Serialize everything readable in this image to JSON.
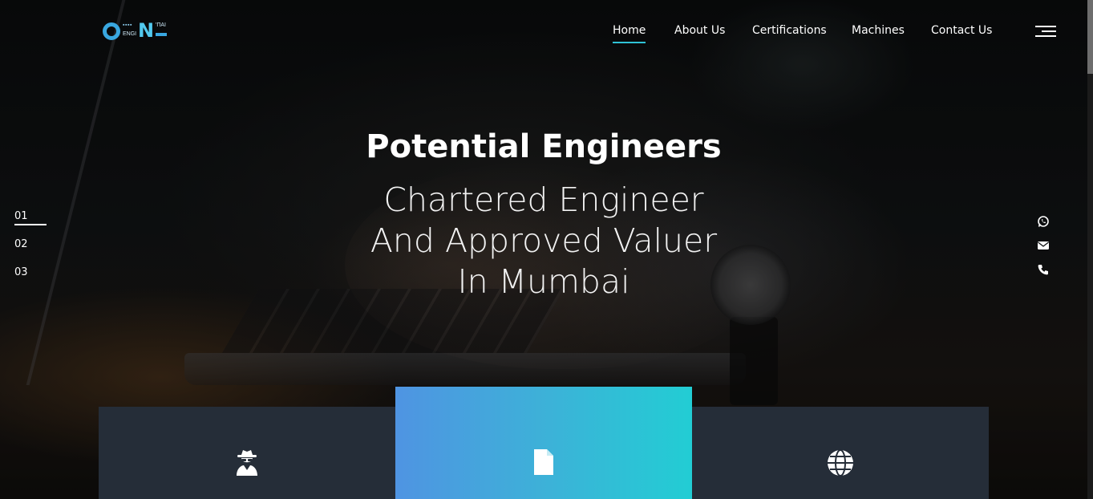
{
  "brand": {
    "logo_alt": "Potential Engineers logo",
    "accent_color": "#2fc2d6"
  },
  "nav": {
    "items": [
      {
        "label": "Home",
        "active": true
      },
      {
        "label": "About Us",
        "active": false
      },
      {
        "label": "Certifications",
        "active": false
      },
      {
        "label": "Machines",
        "active": false
      },
      {
        "label": "Contact Us",
        "active": false
      }
    ],
    "menu_icon": "hamburger-menu-icon"
  },
  "hero": {
    "title": "Potential Engineers",
    "subtitle_lines": [
      "Chartered Engineer",
      "And Approved Valuer",
      "In Mumbai"
    ]
  },
  "slider": {
    "pages": [
      "01",
      "02",
      "03"
    ],
    "active_index": 0
  },
  "social": {
    "icons": [
      "whatsapp-icon",
      "email-icon",
      "phone-icon"
    ]
  },
  "features": {
    "cards": [
      {
        "icon": "spy-agent-icon",
        "active": false
      },
      {
        "icon": "document-icon",
        "active": true
      },
      {
        "icon": "globe-icon",
        "active": false
      }
    ],
    "active_gradient": [
      "#4f94e2",
      "#22cdd4"
    ],
    "card_color": "#252d38"
  }
}
